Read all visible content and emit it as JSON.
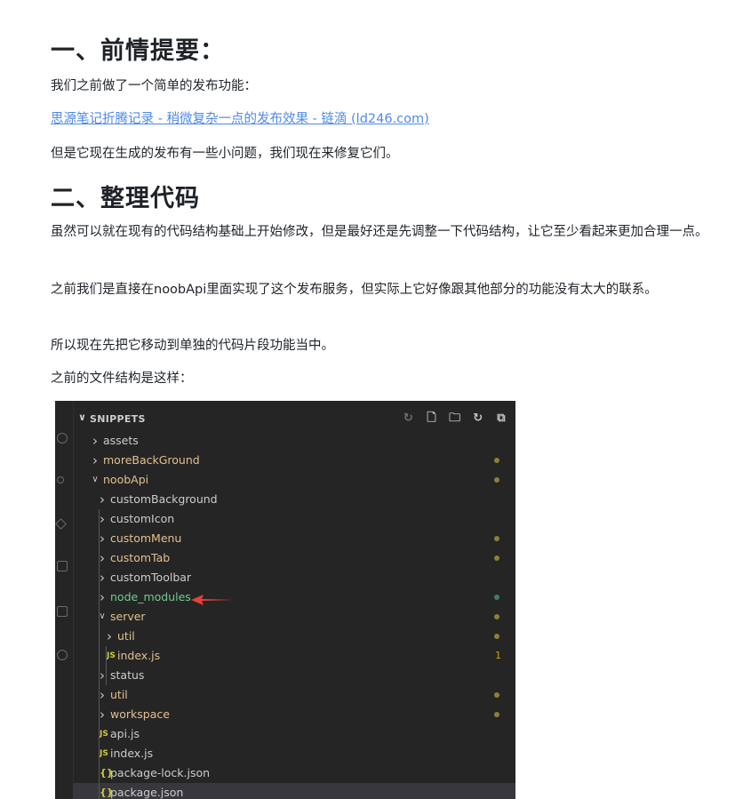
{
  "article": {
    "h1": "一、前情提要：",
    "p1": "我们之前做了一个简单的发布功能：",
    "link": "思源笔记折腾记录 - 稍微复杂一点的发布效果 - 链滴 (ld246.com)",
    "p2": "但是它现在生成的发布有一些小问题，我们现在来修复它们。",
    "h2": "二、整理代码",
    "p3": "虽然可以就在现有的代码结构基础上开始修改，但是最好还是先调整一下代码结构，让它至少看起来更加合理一点。",
    "p4": "之前我们是直接在noobApi里面实现了这个发布服务，但实际上它好像跟其他部分的功能没有太大的联系。",
    "p5": "所以现在先把它移动到单独的代码片段功能当中。",
    "p6": "之前的文件结构是这样："
  },
  "explorer": {
    "title": "SNIPPETS",
    "colors": {
      "modified": "#e2c08d",
      "untracked": "#73c991",
      "normal": "#cccccc",
      "dot_modified": "#8e7f3b",
      "dot_untracked": "#3f7f63",
      "background": "#252526",
      "arrow": "#e8403a"
    },
    "header_actions": [
      "refresh-icon",
      "new-file-icon",
      "new-folder-icon",
      "refresh-icon",
      "collapse-all-icon"
    ],
    "items": [
      {
        "label": "assets",
        "type": "folder",
        "state": "normal"
      },
      {
        "label": "moreBackGround",
        "type": "folder",
        "state": "modified"
      },
      {
        "label": "noobApi",
        "type": "folder-open",
        "state": "modified"
      },
      {
        "label": "customBackground",
        "type": "folder",
        "state": "normal"
      },
      {
        "label": "customIcon",
        "type": "folder",
        "state": "normal"
      },
      {
        "label": "customMenu",
        "type": "folder",
        "state": "modified"
      },
      {
        "label": "customTab",
        "type": "folder",
        "state": "modified"
      },
      {
        "label": "customToolbar",
        "type": "folder",
        "state": "normal"
      },
      {
        "label": "node_modules",
        "type": "folder",
        "state": "untracked"
      },
      {
        "label": "server",
        "type": "folder-open",
        "state": "modified"
      },
      {
        "label": "util",
        "type": "folder",
        "state": "modified"
      },
      {
        "label": "index.js",
        "type": "js",
        "state": "modified",
        "badge": "1"
      },
      {
        "label": "status",
        "type": "folder",
        "state": "normal"
      },
      {
        "label": "util",
        "type": "folder",
        "state": "modified"
      },
      {
        "label": "workspace",
        "type": "folder",
        "state": "modified"
      },
      {
        "label": "api.js",
        "type": "js",
        "state": "normal"
      },
      {
        "label": "index.js",
        "type": "js",
        "state": "normal"
      },
      {
        "label": "package-lock.json",
        "type": "json",
        "state": "normal"
      },
      {
        "label": "package.json",
        "type": "json",
        "state": "normal"
      }
    ]
  }
}
